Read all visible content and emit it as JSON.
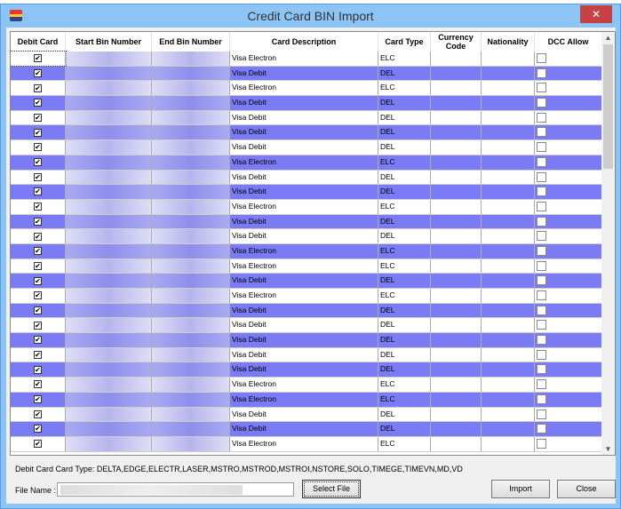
{
  "window": {
    "title": "Credit Card BIN Import",
    "close": "✕"
  },
  "columns": [
    "Debit Card",
    "Start Bin Number",
    "End Bin Number",
    "Card Description",
    "Card Type",
    "Currency Code",
    "Nationality",
    "DCC Allow"
  ],
  "rows": [
    [
      "Visa Electron",
      "ELC"
    ],
    [
      "Visa Debit",
      "DEL"
    ],
    [
      "Visa Electron",
      "ELC"
    ],
    [
      "Visa Debit",
      "DEL"
    ],
    [
      "Visa Debit",
      "DEL"
    ],
    [
      "Visa Debit",
      "DEL"
    ],
    [
      "Visa Debit",
      "DEL"
    ],
    [
      "Visa Electron",
      "ELC"
    ],
    [
      "Visa Debit",
      "DEL"
    ],
    [
      "Visa Debit",
      "DEL"
    ],
    [
      "Visa Electron",
      "ELC"
    ],
    [
      "Visa Debit",
      "DEL"
    ],
    [
      "Visa Debit",
      "DEL"
    ],
    [
      "Visa Electron",
      "ELC"
    ],
    [
      "Visa Electron",
      "ELC"
    ],
    [
      "Visa Debit",
      "DEL"
    ],
    [
      "Visa Electron",
      "ELC"
    ],
    [
      "Visa Debit",
      "DEL"
    ],
    [
      "Visa Debit",
      "DEL"
    ],
    [
      "Visa Debit",
      "DEL"
    ],
    [
      "Visa Debit",
      "DEL"
    ],
    [
      "Visa Debit",
      "DEL"
    ],
    [
      "Visa Electron",
      "ELC"
    ],
    [
      "Visa Electron",
      "ELC"
    ],
    [
      "Visa Debit",
      "DEL"
    ],
    [
      "Visa Debit",
      "DEL"
    ],
    [
      "Visa Electron",
      "ELC"
    ]
  ],
  "debit_checked": true,
  "dcc_checked": false,
  "info": "Debit Card Card Type: DELTA,EDGE,ELECTR,LASER,MSTRO,MSTROD,MSTROI,NSTORE,SOLO,TIMEGE,TIMEVN,MD,VD",
  "file_label": "File Name :",
  "buttons": {
    "select": "Select File",
    "import": "Import",
    "close": "Close"
  },
  "colors": {
    "alt_row": "#7b7bf6",
    "titlebar": "#8cc4f6"
  }
}
